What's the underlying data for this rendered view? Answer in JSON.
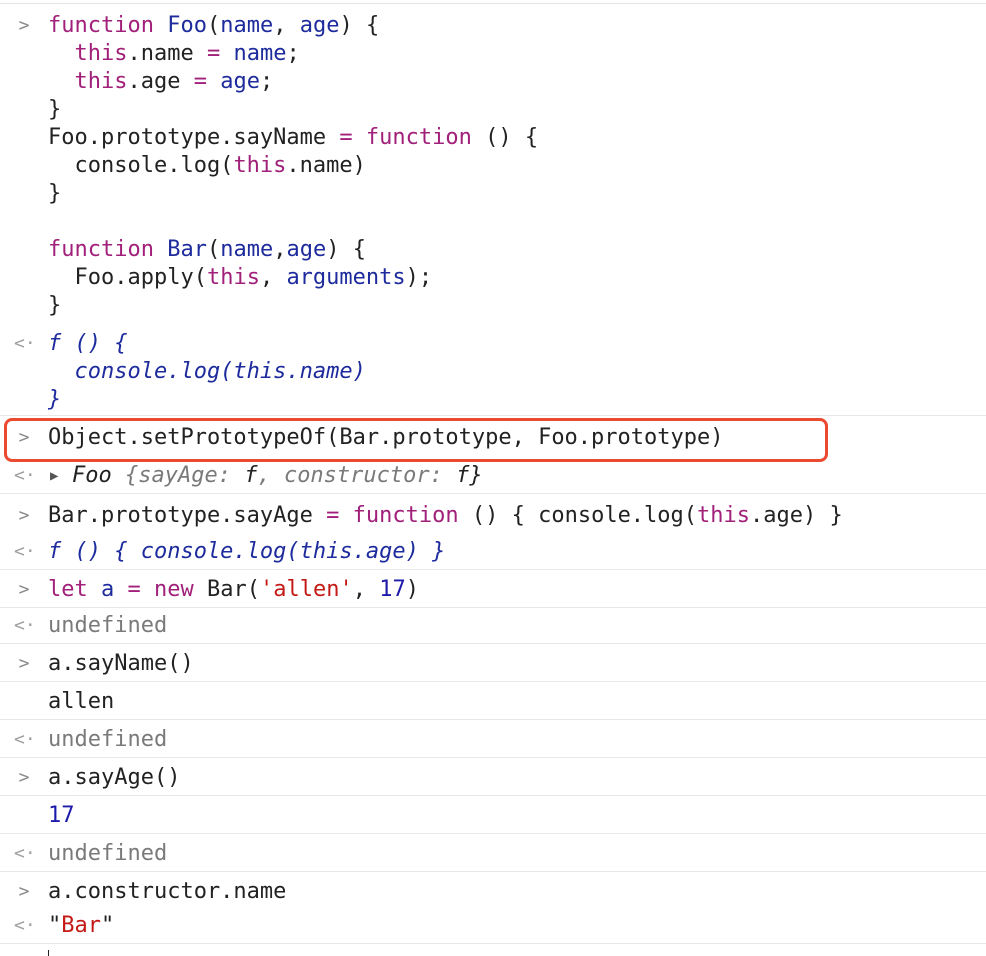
{
  "icons": {
    "input_prompt": "chevron-right-icon",
    "result_marker": "return-arrow-icon",
    "expand": "triangle-right-icon"
  },
  "colors": {
    "keyword": "#a1207a",
    "function_name": "#1d2b9c",
    "string": "#c41a16",
    "number": "#1c1aa8",
    "muted": "#7a7a7a",
    "highlight": "#ea4b30"
  },
  "glyphs": {
    "prompt": ">",
    "result": "<·"
  },
  "entries": {
    "e1_in": {
      "l1": {
        "a": "function",
        "b": " ",
        "c": "Foo",
        "d": "(",
        "e": "name",
        "f": ", ",
        "g": "age",
        "h": ") {"
      },
      "l2": {
        "a": "  ",
        "b": "this",
        "c": ".name ",
        "d": "=",
        "e": " ",
        "f": "name",
        "g": ";"
      },
      "l3": {
        "a": "  ",
        "b": "this",
        "c": ".age ",
        "d": "=",
        "e": " ",
        "f": "age",
        "g": ";"
      },
      "l4": "}",
      "l5": {
        "a": "Foo.prototype.sayName ",
        "b": "=",
        "c": " ",
        "d": "function",
        "e": " () {"
      },
      "l6": {
        "a": "  console.log(",
        "b": "this",
        "c": ".name)"
      },
      "l7": "}",
      "l8": "",
      "l9": {
        "a": "function",
        "b": " ",
        "c": "Bar",
        "d": "(",
        "e": "name",
        "f": ",",
        "g": "age",
        "h": ") {"
      },
      "l10": {
        "a": "  Foo.apply(",
        "b": "this",
        "c": ", ",
        "d": "arguments",
        "e": ");"
      },
      "l11": "}"
    },
    "e1_out": {
      "l1": "f () {",
      "l2": "  console.log(this.name)",
      "l3": "}"
    },
    "e2_in": "Object.setPrototypeOf(Bar.prototype, Foo.prototype)",
    "e2_out": {
      "a": "Foo ",
      "b": "{sayAge: ",
      "c": "f",
      "d": ", constructor: ",
      "e": "f",
      "f": "}"
    },
    "e3_in": {
      "a": "Bar.prototype.sayAge ",
      "b": "=",
      "c": " ",
      "d": "function",
      "e": " () { console.log(",
      "f": "this",
      "g": ".age) }"
    },
    "e3_out": "f () { console.log(this.age) }",
    "e4_in": {
      "a": "let",
      "b": " ",
      "c": "a",
      "d": " ",
      "e": "=",
      "f": " ",
      "g": "new",
      "h": " Bar(",
      "i": "'allen'",
      "j": ", ",
      "k": "17",
      "l": ")"
    },
    "e4_out": "undefined",
    "e5_in": "a.sayName()",
    "e5_log": "allen",
    "e5_out": "undefined",
    "e6_in": "a.sayAge()",
    "e6_log": "17",
    "e6_out": "undefined",
    "e7_in": "a.constructor.name",
    "e7_out": {
      "a": "\"",
      "b": "Bar",
      "c": "\""
    }
  }
}
